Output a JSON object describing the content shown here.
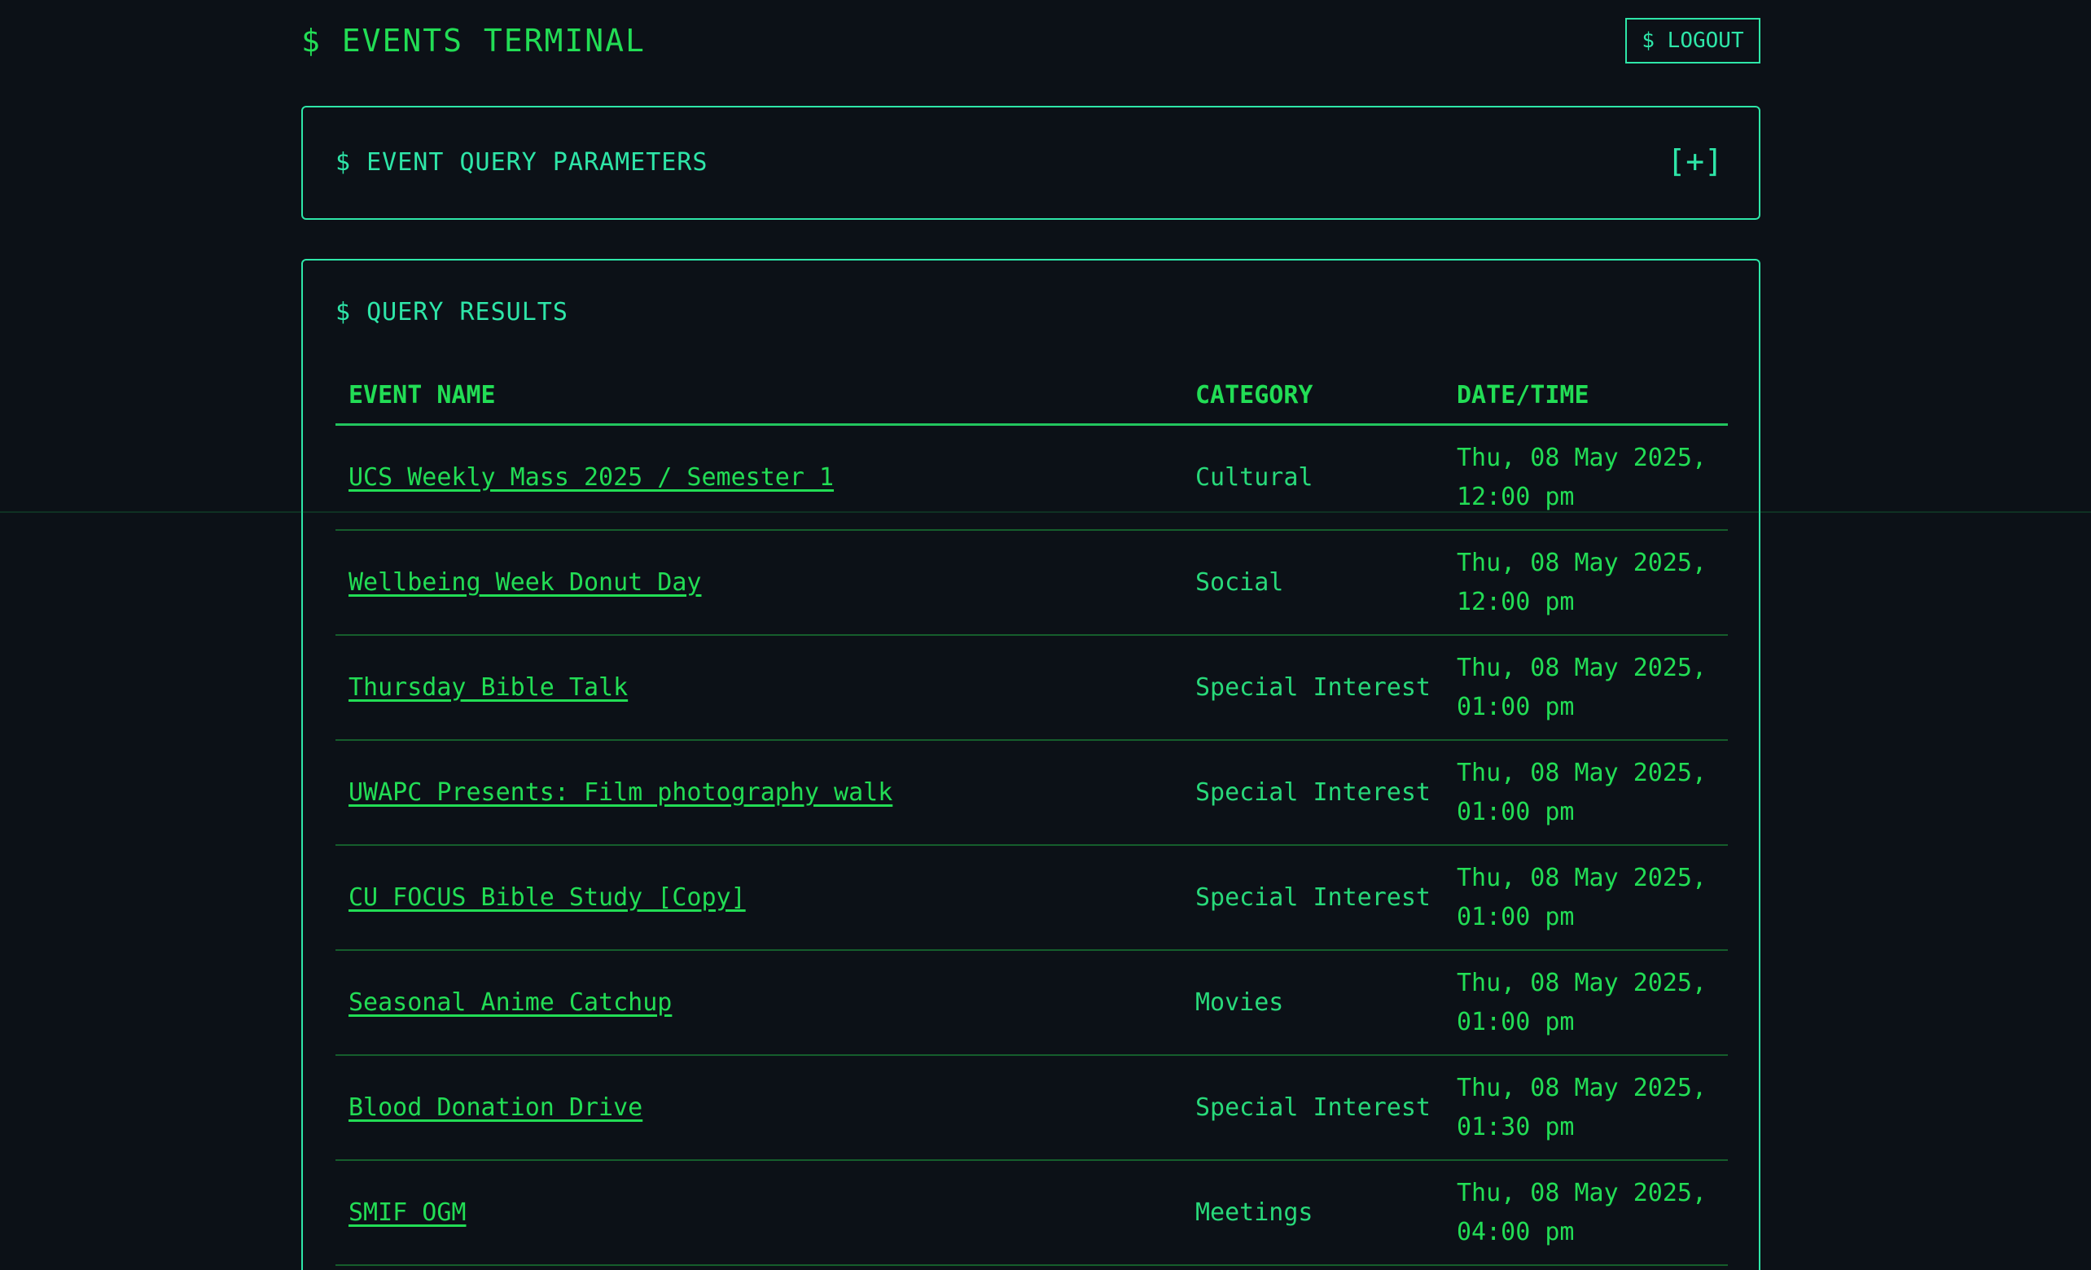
{
  "header": {
    "title": "$ EVENTS TERMINAL",
    "logout_label": "$ LOGOUT"
  },
  "query_params": {
    "title": "$ EVENT QUERY PARAMETERS",
    "toggle_label": "[+]"
  },
  "results": {
    "title": "$ QUERY RESULTS",
    "columns": [
      "EVENT NAME",
      "CATEGORY",
      "DATE/TIME"
    ],
    "rows": [
      {
        "name": "UCS Weekly Mass 2025 / Semester 1",
        "category": "Cultural",
        "datetime": "Thu, 08 May 2025, 12:00 pm"
      },
      {
        "name": "Wellbeing Week Donut Day",
        "category": "Social",
        "datetime": "Thu, 08 May 2025, 12:00 pm"
      },
      {
        "name": "Thursday Bible Talk",
        "category": "Special Interest",
        "datetime": "Thu, 08 May 2025, 01:00 pm"
      },
      {
        "name": "UWAPC Presents: Film photography walk",
        "category": "Special Interest",
        "datetime": "Thu, 08 May 2025, 01:00 pm"
      },
      {
        "name": "CU FOCUS Bible Study [Copy]",
        "category": "Special Interest",
        "datetime": "Thu, 08 May 2025, 01:00 pm"
      },
      {
        "name": "Seasonal Anime Catchup",
        "category": "Movies",
        "datetime": "Thu, 08 May 2025, 01:00 pm"
      },
      {
        "name": "Blood Donation Drive",
        "category": "Special Interest",
        "datetime": "Thu, 08 May 2025, 01:30 pm"
      },
      {
        "name": "SMIF OGM",
        "category": "Meetings",
        "datetime": "Thu, 08 May 2025, 04:00 pm"
      }
    ]
  },
  "colors": {
    "background": "#0c1117",
    "accent": "#22c55e",
    "border": "#2ee6a8"
  }
}
